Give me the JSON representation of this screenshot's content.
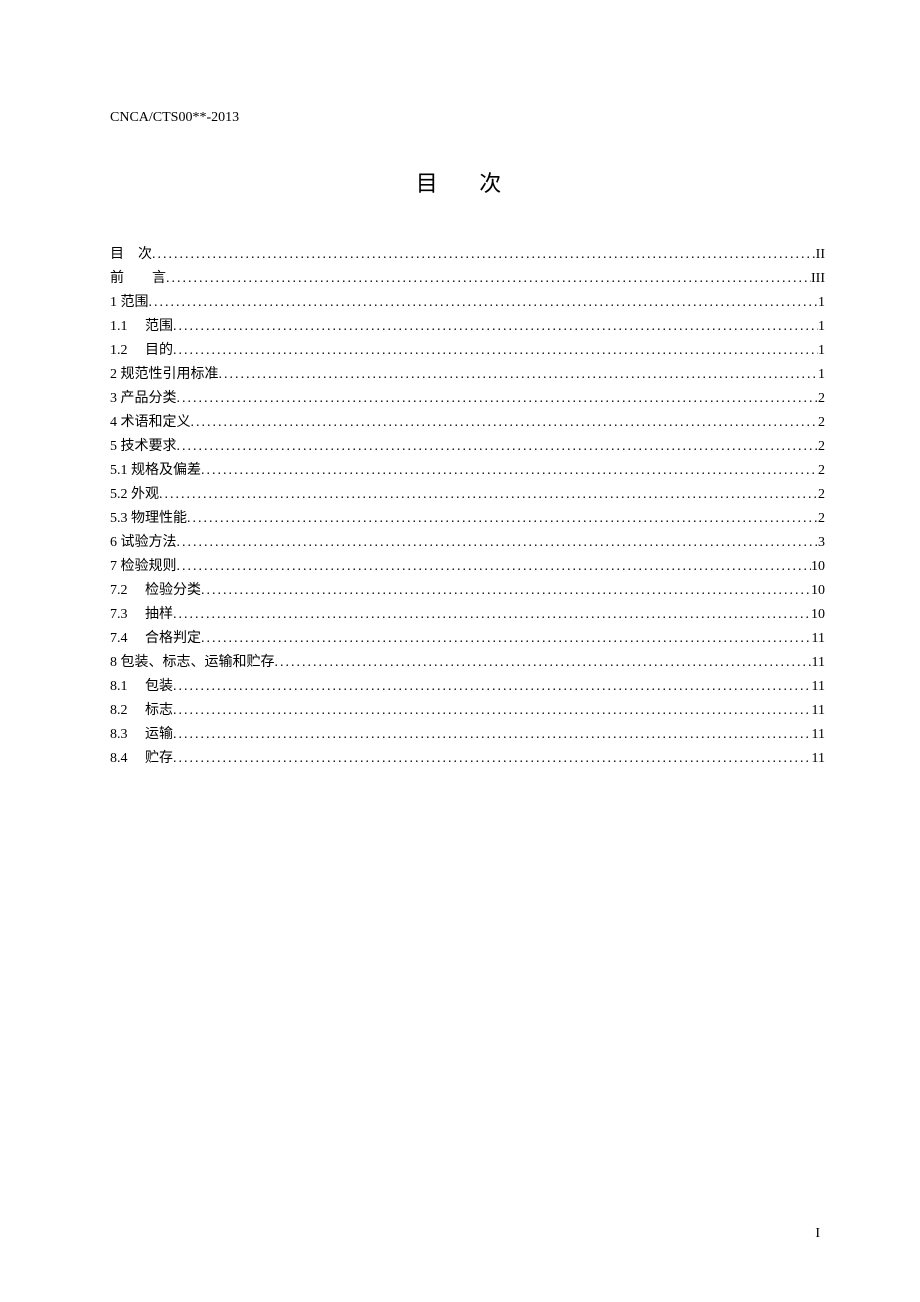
{
  "header": {
    "code": "CNCA/CTS00**-2013"
  },
  "title": "目 次",
  "toc": [
    {
      "label": "目　次",
      "page": "II"
    },
    {
      "label": "前　　言",
      "page": "III"
    },
    {
      "label": "1 范围",
      "page": "1"
    },
    {
      "label": "1.1　 范围",
      "page": "1"
    },
    {
      "label": "1.2　 目的",
      "page": "1"
    },
    {
      "label": "2 规范性引用标准",
      "page": "1"
    },
    {
      "label": "3 产品分类",
      "page": "2"
    },
    {
      "label": "4 术语和定义",
      "page": "2"
    },
    {
      "label": "5 技术要求",
      "page": "2"
    },
    {
      "label": "5.1 规格及偏差",
      "page": "2"
    },
    {
      "label": "5.2 外观",
      "page": "2"
    },
    {
      "label": "5.3 物理性能",
      "page": "2"
    },
    {
      "label": "6 试验方法",
      "page": "3"
    },
    {
      "label": "7 检验规则",
      "page": "10"
    },
    {
      "label": "7.2　 检验分类",
      "page": "10"
    },
    {
      "label": "7.3　 抽样",
      "page": "10"
    },
    {
      "label": "7.4　 合格判定",
      "page": "11"
    },
    {
      "label": "8 包装、标志、运输和贮存",
      "page": "11"
    },
    {
      "label": "8.1　 包装",
      "page": "11"
    },
    {
      "label": "8.2　 标志",
      "page": "11"
    },
    {
      "label": "8.3　 运输",
      "page": "11"
    },
    {
      "label": "8.4　 贮存",
      "page": "11"
    }
  ],
  "footer": {
    "pageNumber": "I"
  }
}
